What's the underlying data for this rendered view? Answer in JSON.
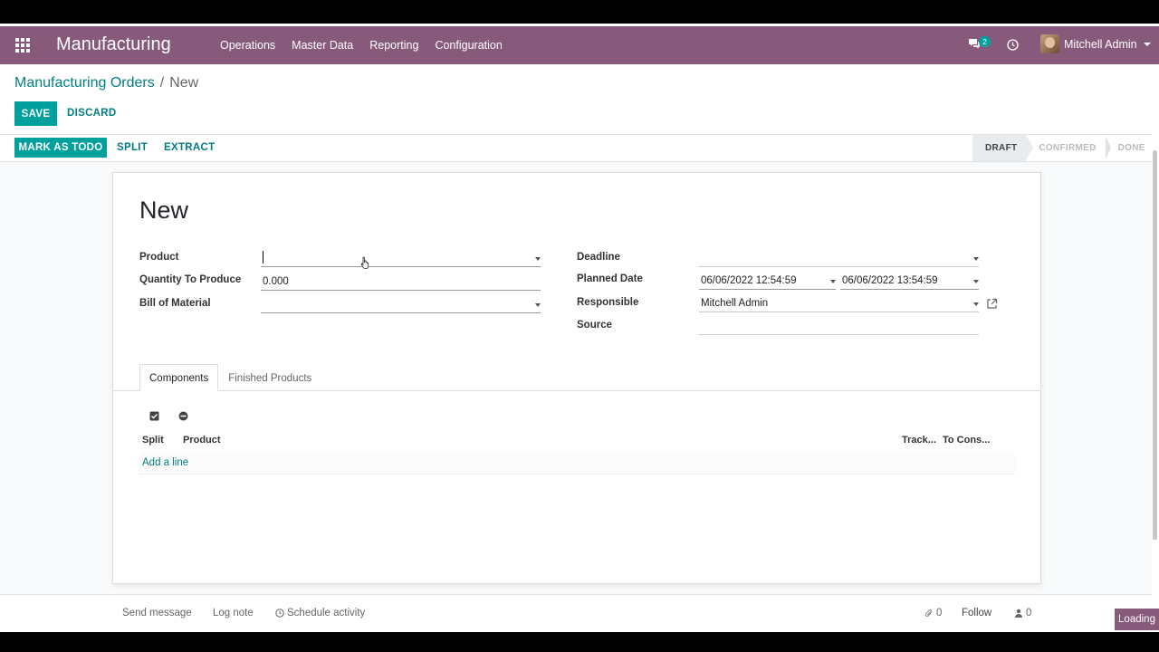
{
  "navbar": {
    "brand": "Manufacturing",
    "menu": [
      "Operations",
      "Master Data",
      "Reporting",
      "Configuration"
    ],
    "chat_badge": "2",
    "user_name": "Mitchell Admin",
    "color": "#875a7b"
  },
  "breadcrumb": {
    "parent": "Manufacturing Orders",
    "separator": "/",
    "current": "New"
  },
  "buttons": {
    "save": "SAVE",
    "discard": "DISCARD",
    "mark_as_todo": "MARK AS TODO",
    "split": "SPLIT",
    "extract": "EXTRACT"
  },
  "stages": [
    "DRAFT",
    "CONFIRMED",
    "DONE"
  ],
  "active_stage": "DRAFT",
  "form": {
    "title": "New",
    "labels": {
      "product": "Product",
      "quantity": "Quantity To Produce",
      "bom": "Bill of Material",
      "deadline": "Deadline",
      "planned_date": "Planned Date",
      "responsible": "Responsible",
      "source": "Source"
    },
    "values": {
      "product": "",
      "quantity": "0.000",
      "bom": "",
      "deadline": "",
      "planned_start": "06/06/2022 12:54:59",
      "planned_end": "06/06/2022 13:54:59",
      "responsible": "Mitchell Admin",
      "source": ""
    },
    "tabs": [
      "Components",
      "Finished Products"
    ],
    "active_tab": "Components",
    "table": {
      "headers": [
        "Split",
        "Product",
        "Track...",
        "To Cons..."
      ],
      "add_line": "Add a line"
    }
  },
  "chatter": {
    "send_message": "Send message",
    "log_note": "Log note",
    "schedule_activity": "Schedule activity",
    "attachments": "0",
    "follow": "Follow",
    "followers": "0"
  },
  "loading": "Loading",
  "colors": {
    "accent": "#00a09d",
    "link": "#017e84",
    "brand": "#875a7b"
  }
}
